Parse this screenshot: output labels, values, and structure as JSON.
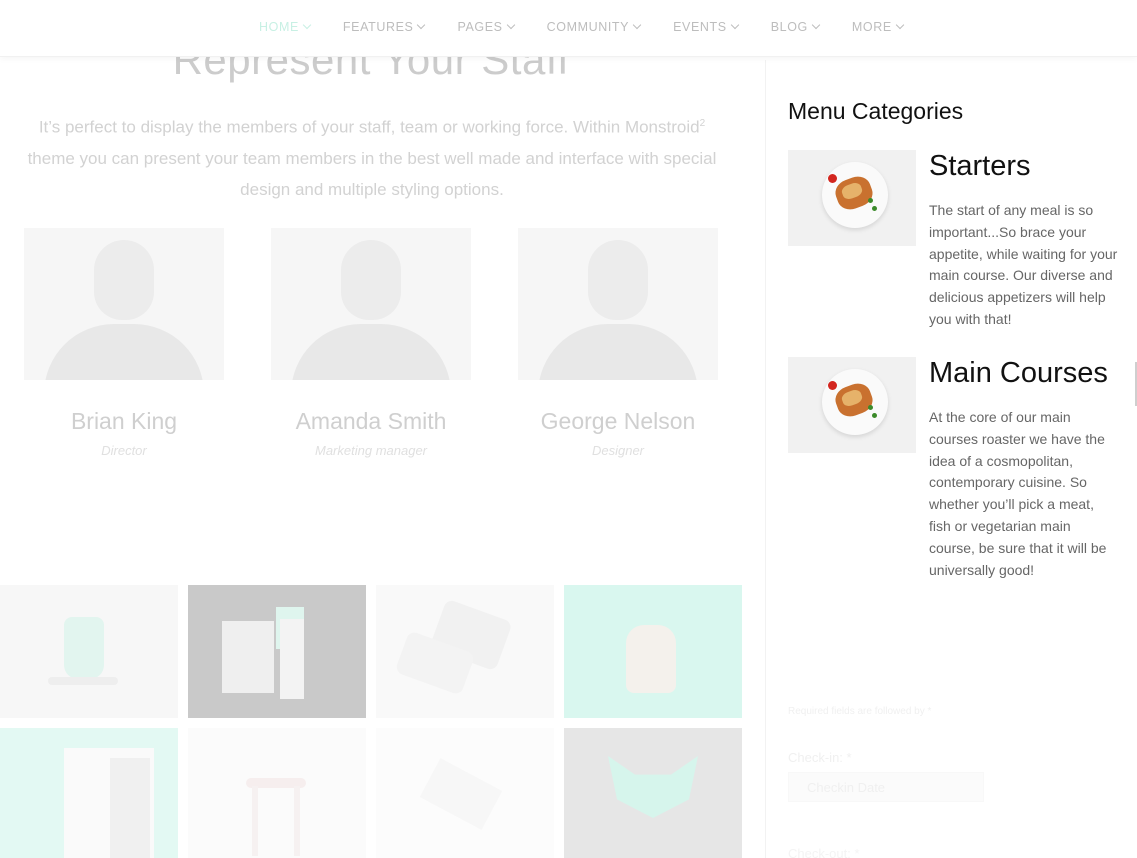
{
  "nav": {
    "items": [
      {
        "label": "HOME",
        "active": true
      },
      {
        "label": "FEATURES",
        "active": false
      },
      {
        "label": "PAGES",
        "active": false
      },
      {
        "label": "COMMUNITY",
        "active": false
      },
      {
        "label": "EVENTS",
        "active": false
      },
      {
        "label": "BLOG",
        "active": false
      },
      {
        "label": "MORE",
        "active": false
      }
    ],
    "accent_color": "#c8f0e4"
  },
  "background": {
    "title": "Represent Your Staff",
    "intro_part1": "It’s perfect to display the members of your staff, team or working force. Within Monstroid",
    "intro_sup": "2",
    "intro_part2": " theme you can present your team members in the best well made and interface with special design and multiple styling options.",
    "team": [
      {
        "name": "Brian King",
        "role": "Director"
      },
      {
        "name": "Amanda Smith",
        "role": "Marketing manager"
      },
      {
        "name": "George Nelson",
        "role": "Designer"
      }
    ],
    "gallery_colors": [
      "#f7f7f7",
      "#c9c9c9",
      "#f9f9f9",
      "#d9f7ef",
      "#e3f9f3",
      "#fbfbfb",
      "#fcfcfc",
      "#e6e6e6"
    ]
  },
  "sidebar": {
    "heading": "Menu Categories",
    "categories": [
      {
        "title": "Starters",
        "description": "The start of any meal is so important...So brace your appetite, while waiting for your main course. Our diverse and delicious appetizers will help you with that!"
      },
      {
        "title": "Main Courses",
        "description": "At the core of our main courses roaster we have the idea of a cosmopolitan, contemporary cuisine. So whether you’ll pick a meat, fish or vegetarian main course, be sure that it will be universally good!"
      }
    ],
    "form": {
      "required_note": "Required fields are followed by *",
      "checkin_label": "Check-in: *",
      "checkin_placeholder": "Checkin Date",
      "checkout_label": "Check-out: *"
    }
  }
}
